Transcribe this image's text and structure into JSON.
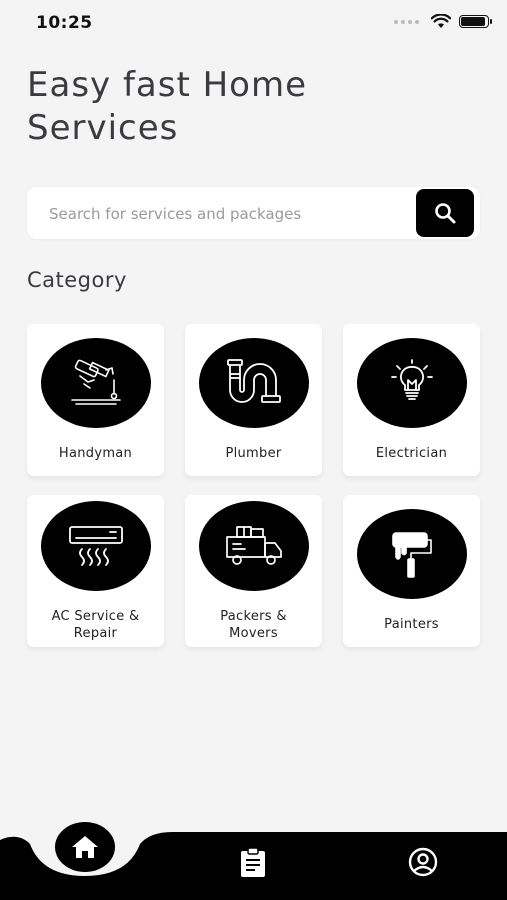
{
  "status_bar": {
    "time": "10:25"
  },
  "header": {
    "title_line1": "Easy fast Home",
    "title_line2": "Services"
  },
  "search": {
    "placeholder": "Search for services and packages"
  },
  "category_section": {
    "title": "Category"
  },
  "categories": [
    {
      "label": "Handyman",
      "icon": "handyman-icon"
    },
    {
      "label": "Plumber",
      "icon": "plumber-pipe-icon"
    },
    {
      "label": "Electrician",
      "icon": "lightbulb-icon"
    },
    {
      "label_line1": "AC Service &",
      "label_line2": "Repair",
      "icon": "air-conditioner-icon"
    },
    {
      "label_line1": "Packers &",
      "label_line2": "Movers",
      "icon": "moving-truck-icon"
    },
    {
      "label": "Painters",
      "icon": "paint-roller-icon"
    }
  ],
  "bottom_nav": {
    "items": [
      {
        "name": "home",
        "icon": "home-icon",
        "active": true
      },
      {
        "name": "orders",
        "icon": "clipboard-icon",
        "active": false
      },
      {
        "name": "profile",
        "icon": "profile-icon",
        "active": false
      }
    ]
  },
  "colors": {
    "background": "#f4f4f5",
    "accent": "#000000",
    "card": "#ffffff",
    "title_text": "#3a3a40"
  }
}
